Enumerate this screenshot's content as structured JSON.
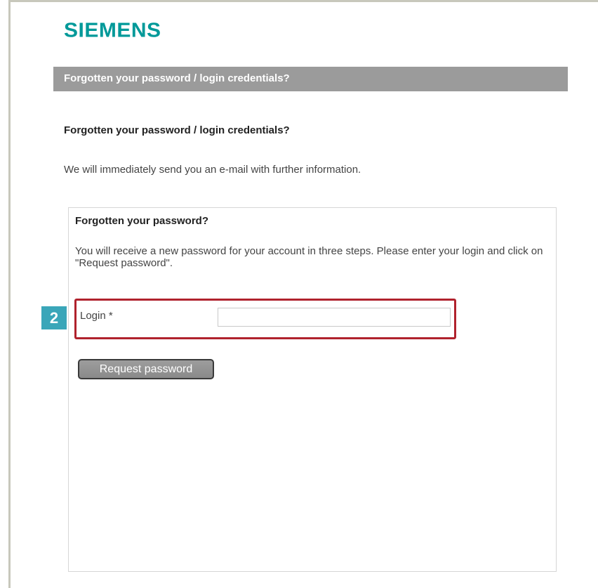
{
  "brand": {
    "logo_text": "SIEMENS",
    "accent_color": "#009999"
  },
  "header": {
    "title": "Forgotten your password / login credentials?"
  },
  "main": {
    "section_title": "Forgotten your password / login credentials?",
    "intro": "We will immediately send you an e-mail with further information."
  },
  "form": {
    "title": "Forgotten your password?",
    "description": "You will receive a new password for your account in three steps. Please enter your login and click on \"Request password\".",
    "step_badge": "2",
    "login_label": "Login *",
    "login_value": "",
    "submit_label": "Request password"
  },
  "colors": {
    "header_bar": "#9b9b9b",
    "step_badge": "#3aa6b9",
    "highlight_border": "#b0222d"
  }
}
